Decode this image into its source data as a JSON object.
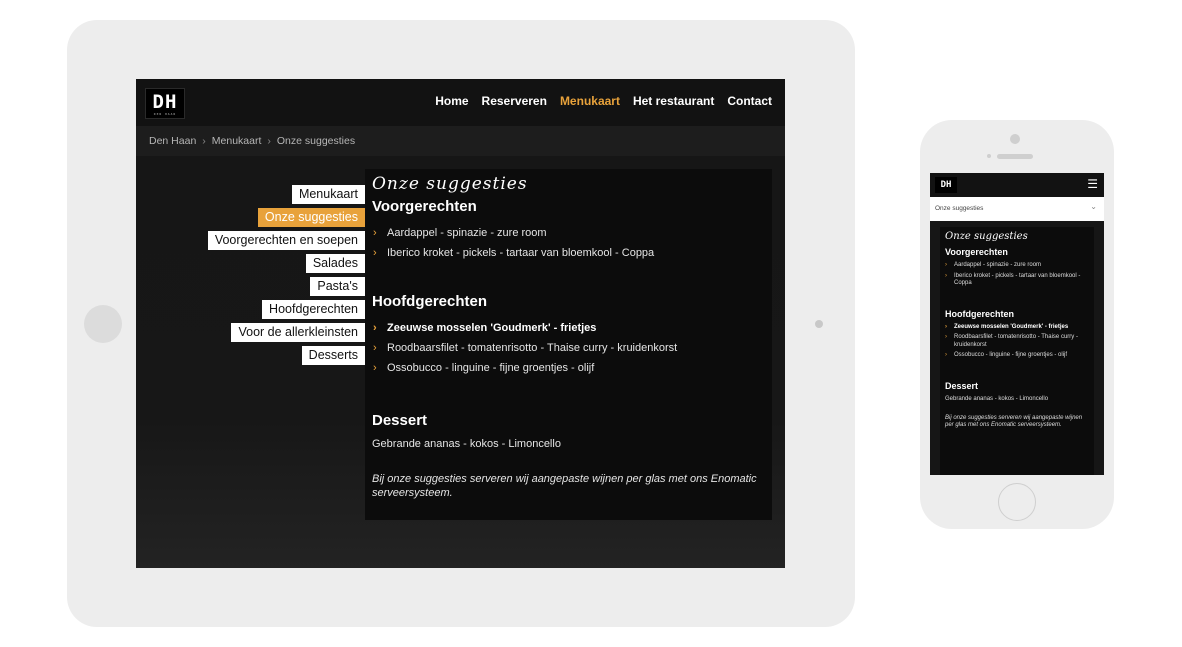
{
  "tablet": {
    "logo": {
      "text": "DH",
      "subtext": "DEN HAAN"
    },
    "nav": [
      "Home",
      "Reserveren",
      "Menukaart",
      "Het restaurant",
      "Contact"
    ],
    "nav_active": "Menukaart",
    "breadcrumb": [
      "Den Haan",
      "Menukaart",
      "Onze suggesties"
    ],
    "breadcrumb_separator": "›",
    "sidemenu": [
      "Menukaart",
      "Onze suggesties",
      "Voorgerechten en soepen",
      "Salades",
      "Pasta's",
      "Hoofdgerechten",
      "Voor de allerkleinsten",
      "Desserts"
    ],
    "sidemenu_active": "Onze suggesties",
    "content": {
      "script_title": "Onze suggesties",
      "section1_title": "Voorgerechten",
      "section1_items": [
        "Aardappel - spinazie - zure room",
        "Iberico kroket - pickels - tartaar van bloemkool - Coppa"
      ],
      "section2_title": "Hoofdgerechten",
      "section2_items": [
        "Zeeuwse mosselen 'Goudmerk' - frietjes",
        "Roodbaarsfilet - tomatenrisotto - Thaise curry - kruidenkorst",
        "Ossobucco - linguine - fijne groentjes - olijf"
      ],
      "section3_title": "Dessert",
      "section3_text": "Gebrande ananas - kokos - Limoncello",
      "note": "Bij onze suggesties serveren wij aangepaste wijnen per glas met ons Enomatic serveersysteem."
    }
  },
  "phone": {
    "logo": "DH",
    "menu_icon": "hamburger-icon",
    "dropdown_value": "Onze suggesties",
    "content": {
      "script_title": "Onze suggesties",
      "section1_title": "Voorgerechten",
      "section1_items": [
        "Aardappel - spinazie - zure room",
        "Iberico kroket - pickels - tartaar van bloemkool - Coppa"
      ],
      "section2_title": "Hoofdgerechten",
      "section2_items": [
        "Zeeuwse mosselen 'Goudmerk' - frietjes",
        "Roodbaarsfilet - tomatenrisotto - Thaise curry - kruidenkorst",
        "Ossobucco - linguine - fijne groentjes - olijf"
      ],
      "section3_title": "Dessert",
      "section3_text": "Gebrande ananas - kokos - Limoncello",
      "note": "Bij onze suggesties serveren wij aangepaste wijnen per glas met ons Enomatic serveersysteem."
    }
  },
  "colors": {
    "accent": "#e8a23b",
    "background_dark": "#161616",
    "content_bg": "#0c0c0c",
    "device_frame": "#ededed"
  }
}
